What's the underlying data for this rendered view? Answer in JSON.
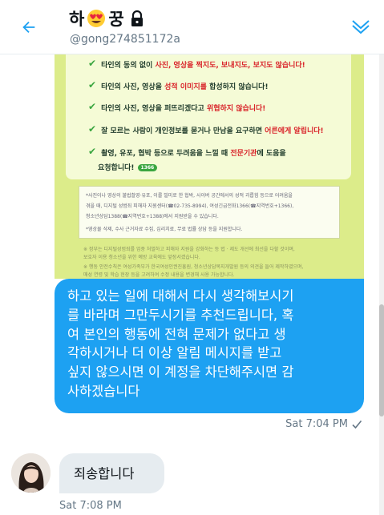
{
  "header": {
    "title_prefix": "하",
    "title_suffix": "꿍",
    "handle": "@gong274851172a",
    "icons": {
      "back": "back-arrow-icon",
      "title_emoji": "heart-eyes-emoji-icon",
      "lock": "lock-icon",
      "info": "conversation-info-icon"
    },
    "accent_color": "#1da1f2"
  },
  "poster": {
    "rules": [
      {
        "pre": "타인의 동의 없이 ",
        "hl": "사진, 영상을 찍지도, 보내지도, 보지도 않습니다!",
        "post": ""
      },
      {
        "pre": "타인의 사진, 영상을 ",
        "hl": "성적 이미지를",
        "post": " 합성하지 않습니다!"
      },
      {
        "pre": "타인의 사진, 영상을 퍼뜨리겠다고 ",
        "hl": "위협하지 않습니다!",
        "post": ""
      },
      {
        "pre": "잘 모르는 사람이 개인정보를 묻거나 만남을 요구하면 ",
        "hl": "어른에게 알립니다!",
        "post": ""
      },
      {
        "pre": "촬영, 유포, 협박 등으로 두려움을 느낄 때 ",
        "hl": "전문기관",
        "post": "에 도움을"
      },
      {
        "pre": "요청합니다!",
        "hl": "",
        "post": ""
      }
    ],
    "badge": "1366",
    "notes": [
      "*사진이나 영상의 불법촬영·유포, 이를 빌미로 한 협박, 사이버 공간에서의 성적 괴롭힘 등으로 어려움을",
      "겪을 때, 디지털 성범죄 피해자 지원센터(☎02-735-8994), 여성긴급전화1366(☎지역번호+1366),",
      "청소년상담1388(☎지역번호+1388)에서 지원받을 수 있습니다.",
      "*영상물 삭제, 수사 근거자료 수집, 심리치료, 무료 법률 상담 등을 지원합니다."
    ],
    "footnotes": [
      "※ 정부는 디지털성범죄를 엄중 처벌하고 피해자 지원을 강화하는 등 법 · 제도 개선에 최선을 다할 것이며,",
      "보호자 이용 청소년을 위한 예방 교육에도 앞장서겠습니다.",
      "※ 행동 안전수칙은 여성가족부가 한국여성인권진흥원, 청소년상담복지개발원 등의 의견을 들어 제작하였으며,",
      "매성 연령 및 학습 현장 등을 고려하여 수정 내용을 변경해 사용 가능합니다."
    ]
  },
  "messages": {
    "sent": {
      "lines": [
        "하고 있는 일에 대해서 다시 생각해보시기",
        "를 바라며 그만두시기를 추천드립니다, 혹",
        "여 본인의 행동에 전혀 문제가 없다고 생",
        "각하시거나 더 이상 알림 메시지를 받고",
        "싶지 않으시면 이 계정을 차단해주시면 감",
        "사하겠습니다"
      ],
      "time": "Sat 7:04 PM",
      "status_icon": "sent-check-icon"
    },
    "received": {
      "text": "죄송합니다",
      "time": "Sat 7:08 PM",
      "avatar": "avatar"
    }
  }
}
